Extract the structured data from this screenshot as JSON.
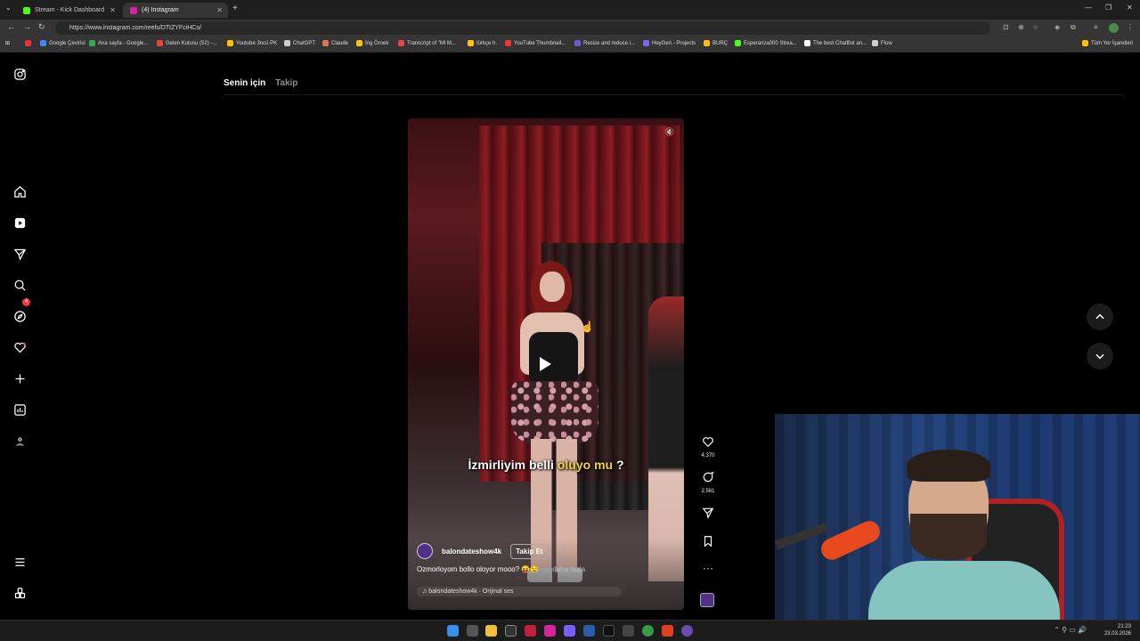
{
  "browser": {
    "tabs": [
      {
        "title": "Stream - Kick Dashboard",
        "fav_color": "#53fc18"
      },
      {
        "title": "(4) Instagram",
        "fav_color": "#d6249f"
      }
    ],
    "url": "https://www.instagram.com/reels/DTtZYFciHCo/",
    "bookmarks": [
      {
        "label": "Google Çevirisi",
        "color": "#4285f4"
      },
      {
        "label": "Ana sayfa - Google...",
        "color": "#34a853"
      },
      {
        "label": "Gelen Kutusu (52) -...",
        "color": "#ea4335"
      },
      {
        "label": "Youtube 3ncü PK",
        "color": "#ffc107"
      },
      {
        "label": "ChatGPT",
        "color": "#cccccc"
      },
      {
        "label": "Claude",
        "color": "#d97757"
      },
      {
        "label": "İng Örnek",
        "color": "#ffc107"
      },
      {
        "label": "Transcript of \"Ml M...",
        "color": "#e44"
      },
      {
        "label": "türkçe h.",
        "color": "#ffc107"
      },
      {
        "label": "YouTube Thumbnail...",
        "color": "#e33"
      },
      {
        "label": "Resize and reduce i...",
        "color": "#6a5acd"
      },
      {
        "label": "HeyGen - Projects",
        "color": "#7b68ee"
      },
      {
        "label": "BURÇ",
        "color": "#ffc107"
      },
      {
        "label": "Esperanza000 Strea...",
        "color": "#53fc18"
      },
      {
        "label": "The best ChatBot an...",
        "color": "#ffffff"
      },
      {
        "label": "Flow",
        "color": "#cccccc"
      },
      {
        "label": "Tüm Yer İşaretleri",
        "color": "#ffc107"
      }
    ]
  },
  "sidebar": {
    "notification_count": "4",
    "icons": [
      "instagram-logo-icon",
      "home-icon",
      "reels-icon",
      "messages-icon",
      "search-icon",
      "explore-icon",
      "notifications-icon",
      "create-icon",
      "dashboard-icon",
      "profile-icon",
      "menu-icon",
      "meta-icon"
    ]
  },
  "feed_tabs": {
    "for_you": "Senin için",
    "following": "Takip"
  },
  "reel": {
    "caption_part1": "İzmirliyim belli ",
    "caption_highlight": "oluyo mu",
    "caption_part2": " ?",
    "author": "balondateshow4k",
    "follow_label": "Takip Et",
    "description": "Ozmorloyom bollo oloyor mooo? 😝🤤",
    "more_label": "... daha fazla",
    "audio": "balondateshow4k · Orijinal ses"
  },
  "actions": {
    "likes": "4.370",
    "comments": "2.561"
  },
  "taskbar": {
    "time": "21:23",
    "date": "23.03.2026"
  },
  "colors": {
    "accent": "#ff3040",
    "caption_highlight": "#f0d34a"
  }
}
